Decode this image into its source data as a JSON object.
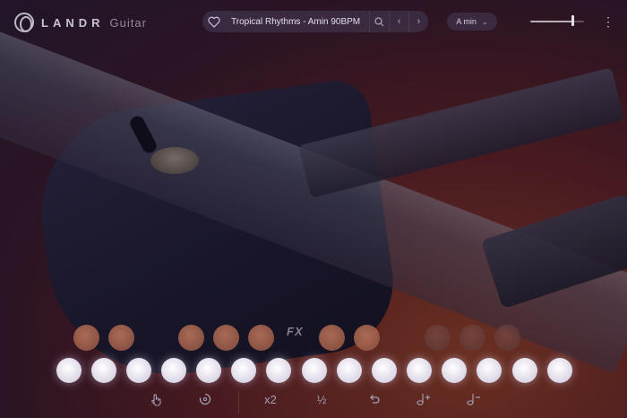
{
  "app": {
    "brand": "LANDR",
    "product": "Guitar"
  },
  "preset": {
    "icon": "heart-icon",
    "name": "Tropical Rhythms - Amin 90BPM",
    "search_icon": "search-icon",
    "prev_icon": "chevron-left-icon",
    "next_icon": "chevron-right-icon"
  },
  "key": {
    "value": "A min",
    "icon": "chevron-down-icon"
  },
  "volume": {
    "level": 0.78
  },
  "menu": {
    "icon": "kebab-icon",
    "glyph": "⋮"
  },
  "fx": {
    "label": "FX"
  },
  "toolbar": {
    "items": [
      {
        "name": "hand-strum-icon",
        "glyph": "☝"
      },
      {
        "name": "rotate-icon",
        "glyph": "↻"
      },
      {
        "name": "double-speed",
        "label": "x2"
      },
      {
        "name": "half-speed",
        "label": "½"
      },
      {
        "name": "undo-icon",
        "glyph": "↶"
      },
      {
        "name": "note-plus-icon",
        "glyph": "♩+"
      },
      {
        "name": "note-minus-icon",
        "glyph": "♩-"
      }
    ]
  },
  "colors": {
    "accent_pad": "#b8745a",
    "active_pad": "#ffffff",
    "panel": "#463c5a"
  }
}
